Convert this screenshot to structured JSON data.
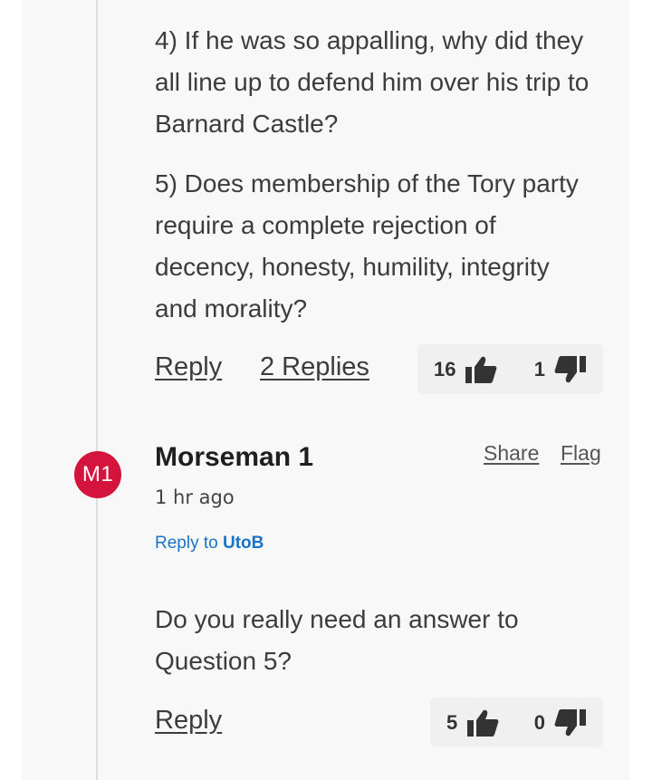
{
  "first_comment": {
    "paragraph_4": "4) If he was so appalling, why did they all line up to defend him over his trip to Barnard Castle?",
    "paragraph_5": "5) Does membership of the Tory party require a complete rejection of decency, honesty, humility, integrity and morality?",
    "reply_label": "Reply",
    "replies_label": "2 Replies",
    "upvotes": "16",
    "downvotes": "1"
  },
  "reply_comment": {
    "avatar_initials": "M1",
    "avatar_color": "#d4143c",
    "author": "Morseman 1",
    "time": "1 hr ago",
    "share_label": "Share",
    "flag_label": "Flag",
    "reply_to_prefix": "Reply to",
    "reply_to_user": "UtoB",
    "body": "Do you really need an answer to Question 5?",
    "reply_label": "Reply",
    "upvotes": "5",
    "downvotes": "0"
  },
  "icons": {
    "upvote": "thumbs-up-icon",
    "downvote": "thumbs-down-icon"
  }
}
